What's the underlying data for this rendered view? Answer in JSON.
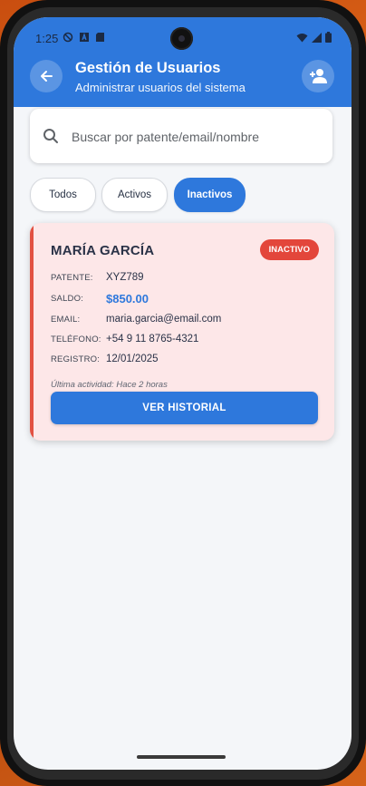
{
  "status_bar": {
    "time": "1:25",
    "left_icons": [
      "vpn-icon",
      "a-icon",
      "sd-card-icon"
    ],
    "right_icons": [
      "wifi-icon",
      "signal-icon",
      "battery-icon"
    ]
  },
  "appbar": {
    "title": "Gestión de Usuarios",
    "subtitle": "Administrar usuarios del sistema",
    "back_icon": "arrow-left-icon",
    "add_user_icon": "person-add-icon",
    "color": "#2e78dc"
  },
  "search": {
    "placeholder": "Buscar por patente/email/nombre",
    "value": ""
  },
  "filters": [
    {
      "label": "Todos",
      "active": false
    },
    {
      "label": "Activos",
      "active": false
    },
    {
      "label": "Inactivos",
      "active": true
    }
  ],
  "user_card": {
    "name": "MARÍA GARCÍA",
    "status": "INACTIVO",
    "status_color": "#e3463b",
    "fields": [
      {
        "label": "PATENTE:",
        "value": "XYZ789"
      },
      {
        "label": "SALDO:",
        "value": "$850.00"
      },
      {
        "label": "EMAIL:",
        "value": "maria.garcia@email.com"
      },
      {
        "label": "TELÉFONO:",
        "value": "+54 9 11 8765-4321"
      },
      {
        "label": "REGISTRO:",
        "value": "12/01/2025"
      }
    ],
    "last_activity": "Última actividad: Hace 2 horas",
    "button_label": "VER HISTORIAL"
  }
}
